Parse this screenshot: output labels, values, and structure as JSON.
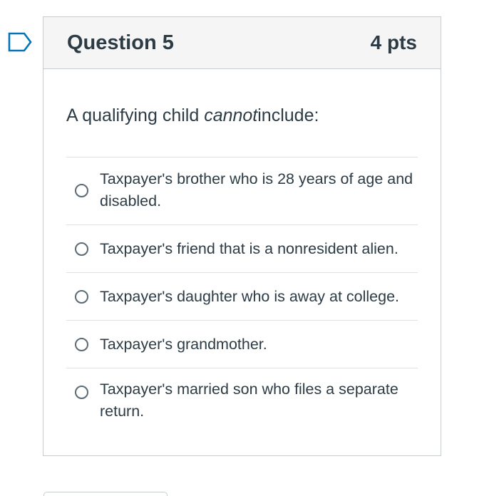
{
  "question": {
    "title": "Question 5",
    "points": "4 pts",
    "text_before": "A qualifying child ",
    "text_emphasis": "cannot",
    "text_after": "include:",
    "answers": [
      {
        "label": "Taxpayer's brother who is 28 years of age and disabled.",
        "selected": false
      },
      {
        "label": "Taxpayer's friend that is a nonresident alien.",
        "selected": false
      },
      {
        "label": "Taxpayer's daughter who is away at college.",
        "selected": false
      },
      {
        "label": "Taxpayer's grandmother.",
        "selected": false
      },
      {
        "label": "Taxpayer's married son who files a separate return.",
        "selected": false
      }
    ]
  },
  "icons": {
    "flag": "flag-question-icon",
    "radio": "radio-unselected-icon"
  },
  "colors": {
    "accent": "#0374b5",
    "text": "#2d3b45",
    "border": "#c7cdd1",
    "header_bg": "#f5f5f5"
  }
}
